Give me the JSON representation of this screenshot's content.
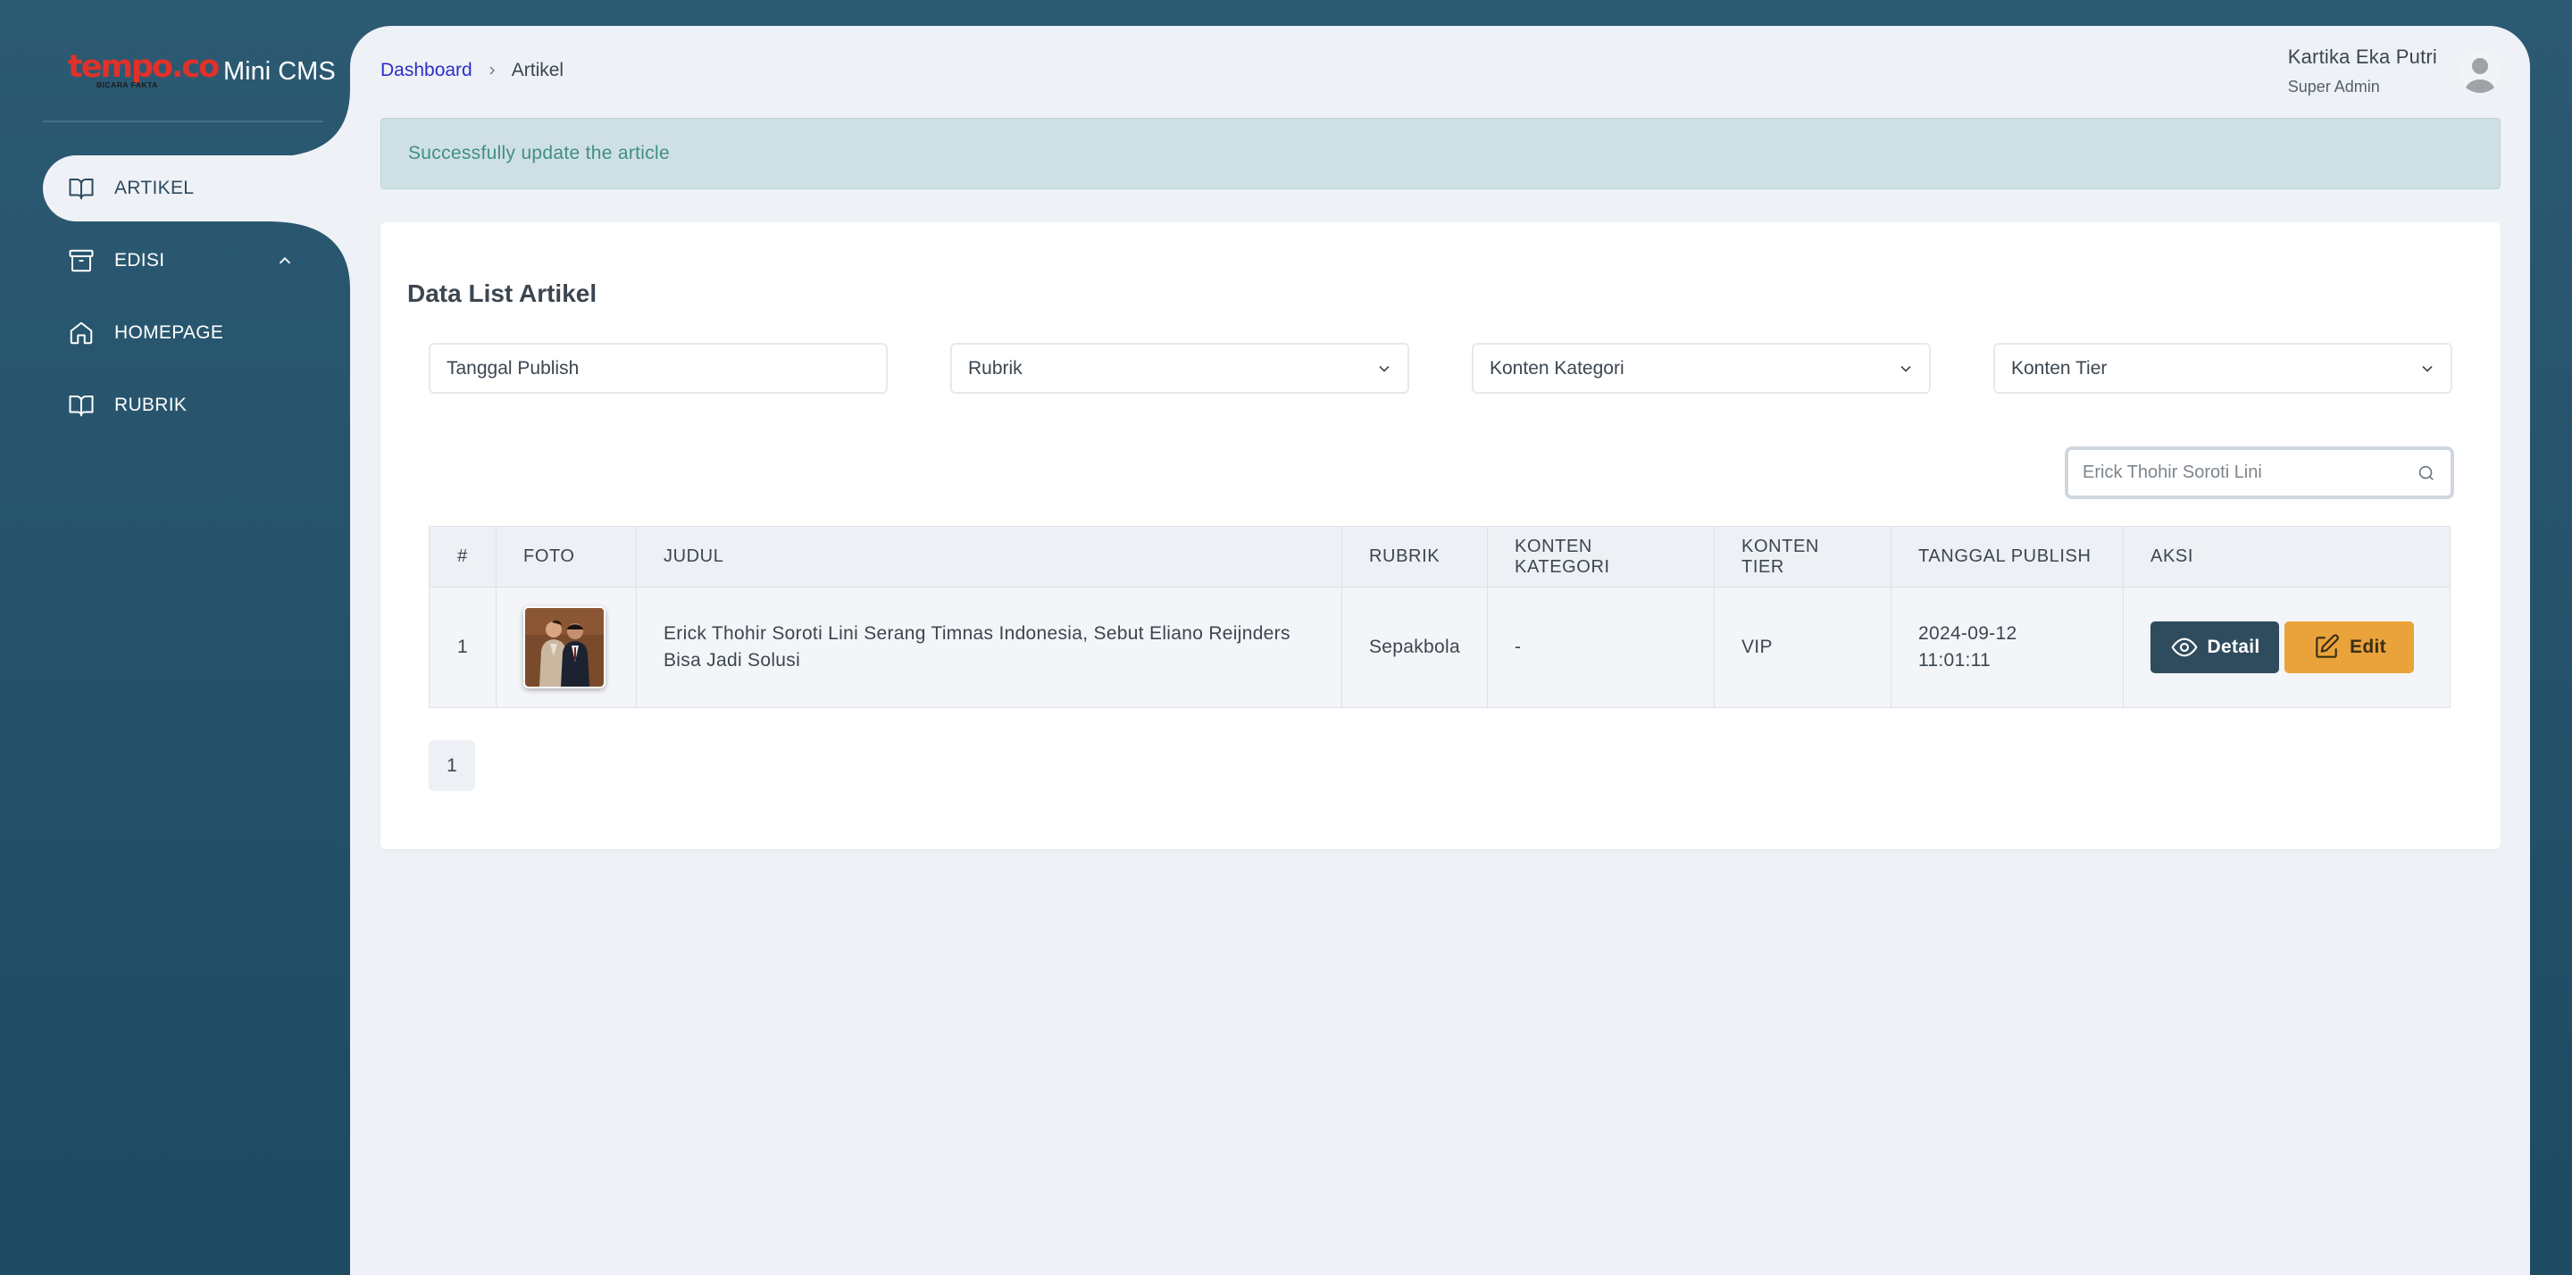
{
  "brand": {
    "logo_text": "tempo.co",
    "logo_tagline": "BICARA FAKTA",
    "app_name": "Mini CMS",
    "logo_color": "#e0312a"
  },
  "sidebar": {
    "items": [
      {
        "label": "ARTIKEL",
        "icon": "book-open-icon",
        "active": true
      },
      {
        "label": "EDISI",
        "icon": "archive-icon",
        "expanded": true
      },
      {
        "label": "HOMEPAGE",
        "icon": "home-icon"
      },
      {
        "label": "RUBRIK",
        "icon": "book-open-icon"
      }
    ]
  },
  "breadcrumb": {
    "root": "Dashboard",
    "current": "Artikel"
  },
  "user": {
    "name": "Kartika Eka Putri",
    "role": "Super Admin"
  },
  "alert": {
    "message": "Successfully update the article"
  },
  "card": {
    "title": "Data List Artikel"
  },
  "filters": {
    "date": "Tanggal Publish",
    "rubrik": "Rubrik",
    "kategori": "Konten Kategori",
    "tier": "Konten Tier"
  },
  "search": {
    "placeholder": "Erick Thohir Soroti Lini"
  },
  "table": {
    "headers": {
      "num": "#",
      "foto": "FOTO",
      "judul": "JUDUL",
      "rubrik": "RUBRIK",
      "kategori": "KONTEN KATEGORI",
      "tier": "KONTEN TIER",
      "tanggal": "TANGGAL PUBLISH",
      "aksi": "AKSI"
    },
    "rows": [
      {
        "num": "1",
        "judul": "Erick Thohir Soroti Lini Serang Timnas Indonesia, Sebut Eliano Reijnders Bisa Jadi Solusi",
        "rubrik": "Sepakbola",
        "kategori": "-",
        "tier": "VIP",
        "tanggal_date": "2024-09-12",
        "tanggal_time": "11:01:11",
        "detail_label": "Detail",
        "edit_label": "Edit"
      }
    ]
  },
  "pagination": {
    "current_page": "1"
  },
  "colors": {
    "sidebar_bg": "#2c5a72",
    "main_bg": "#eef2f7",
    "detail_button": "#2f4b5e",
    "edit_button": "#e9a33a",
    "alert_bg": "#cfe0e4",
    "alert_text": "#3f8f83",
    "link": "#2e2ec8"
  }
}
